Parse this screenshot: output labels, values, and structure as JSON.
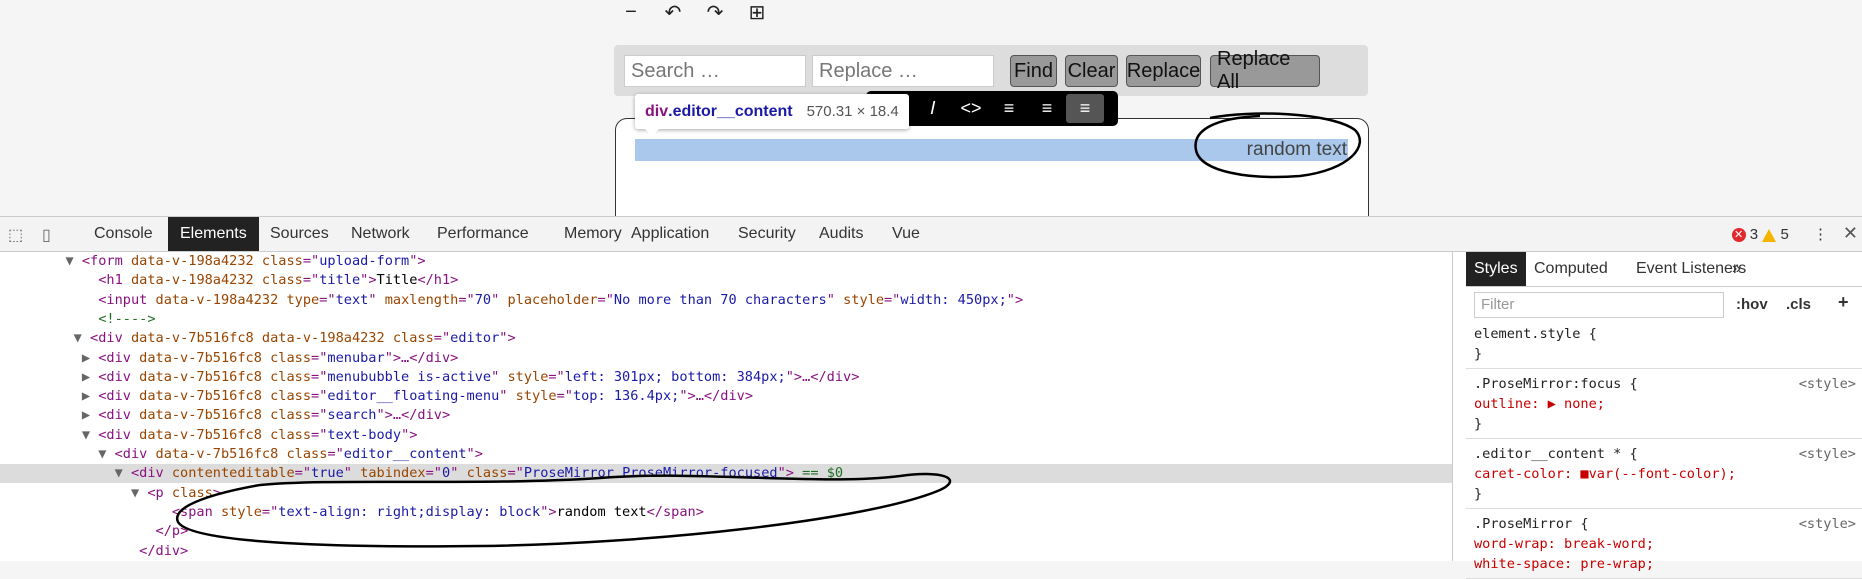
{
  "editor_toolbar": {
    "icons": [
      "minus-icon",
      "undo-icon",
      "redo-icon",
      "table-icon"
    ],
    "glyphs": [
      "−",
      "↶",
      "↷",
      "⊞"
    ]
  },
  "search": {
    "search_placeholder": "Search …",
    "replace_placeholder": "Replace …",
    "find_label": "Find",
    "clear_label": "Clear",
    "replace_label": "Replace",
    "replace_all_label": "Replace All"
  },
  "inspect_tooltip": {
    "tag": "div",
    "class": ".editor__content",
    "size": "570.31 × 18.4"
  },
  "menububble": {
    "icons": [
      "italic-icon",
      "code-icon",
      "align-left-icon",
      "align-center-icon",
      "align-right-icon"
    ],
    "glyphs": [
      "𝐼",
      "<>",
      "≡",
      "≡",
      "≡"
    ]
  },
  "editor": {
    "text": "random text"
  },
  "devtools": {
    "tabs": [
      "Console",
      "Elements",
      "Sources",
      "Network",
      "Performance",
      "Memory",
      "Application",
      "Security",
      "Audits",
      "Vue"
    ],
    "active_tab": "Elements",
    "error_count": "3",
    "warning_count": "5",
    "dom": [
      {
        "indent": "        ",
        "arrow": "▼",
        "html": [
          [
            "tg",
            "<form "
          ],
          [
            "an",
            "data-v-198a4232 class"
          ],
          [
            "tg",
            "=\""
          ],
          [
            "av",
            "upload-form"
          ],
          [
            "tg",
            "\">"
          ]
        ]
      },
      {
        "indent": "          ",
        "arrow": " ",
        "html": [
          [
            "tg",
            "<h1 "
          ],
          [
            "an",
            "data-v-198a4232 class"
          ],
          [
            "tg",
            "=\""
          ],
          [
            "av",
            "title"
          ],
          [
            "tg",
            "\">"
          ],
          [
            "tx",
            "Title"
          ],
          [
            "tg",
            "</h1>"
          ]
        ]
      },
      {
        "indent": "          ",
        "arrow": " ",
        "html": [
          [
            "tg",
            "<input "
          ],
          [
            "an",
            "data-v-198a4232 type"
          ],
          [
            "tg",
            "=\""
          ],
          [
            "av",
            "text"
          ],
          [
            "tg",
            "\" "
          ],
          [
            "an",
            "maxlength"
          ],
          [
            "tg",
            "=\""
          ],
          [
            "av",
            "70"
          ],
          [
            "tg",
            "\" "
          ],
          [
            "an",
            "placeholder"
          ],
          [
            "tg",
            "=\""
          ],
          [
            "av",
            "No more than 70 characters"
          ],
          [
            "tg",
            "\" "
          ],
          [
            "an",
            "style"
          ],
          [
            "tg",
            "=\""
          ],
          [
            "av",
            "width: 450px;"
          ],
          [
            "tg",
            "\">"
          ]
        ]
      },
      {
        "indent": "          ",
        "arrow": " ",
        "html": [
          [
            "cm",
            "<!---->"
          ]
        ]
      },
      {
        "indent": "         ",
        "arrow": "▼",
        "html": [
          [
            "tg",
            "<div "
          ],
          [
            "an",
            "data-v-7b516fc8 data-v-198a4232 class"
          ],
          [
            "tg",
            "=\""
          ],
          [
            "av",
            "editor"
          ],
          [
            "tg",
            "\">"
          ]
        ]
      },
      {
        "indent": "          ",
        "arrow": "▶",
        "html": [
          [
            "tg",
            "<div "
          ],
          [
            "an",
            "data-v-7b516fc8 class"
          ],
          [
            "tg",
            "=\""
          ],
          [
            "av",
            "menubar"
          ],
          [
            "tg",
            "\">…</div>"
          ]
        ]
      },
      {
        "indent": "          ",
        "arrow": "▶",
        "html": [
          [
            "tg",
            "<div "
          ],
          [
            "an",
            "data-v-7b516fc8 class"
          ],
          [
            "tg",
            "=\""
          ],
          [
            "av",
            "menububble is-active"
          ],
          [
            "tg",
            "\" "
          ],
          [
            "an",
            "style"
          ],
          [
            "tg",
            "=\""
          ],
          [
            "av",
            "left: 301px; bottom: 384px;"
          ],
          [
            "tg",
            "\">…</div>"
          ]
        ]
      },
      {
        "indent": "          ",
        "arrow": "▶",
        "html": [
          [
            "tg",
            "<div "
          ],
          [
            "an",
            "data-v-7b516fc8 class"
          ],
          [
            "tg",
            "=\""
          ],
          [
            "av",
            "editor__floating-menu"
          ],
          [
            "tg",
            "\" "
          ],
          [
            "an",
            "style"
          ],
          [
            "tg",
            "=\""
          ],
          [
            "av",
            "top: 136.4px;"
          ],
          [
            "tg",
            "\">…</div>"
          ]
        ]
      },
      {
        "indent": "          ",
        "arrow": "▶",
        "html": [
          [
            "tg",
            "<div "
          ],
          [
            "an",
            "data-v-7b516fc8 class"
          ],
          [
            "tg",
            "=\""
          ],
          [
            "av",
            "search"
          ],
          [
            "tg",
            "\">…</div>"
          ]
        ]
      },
      {
        "indent": "          ",
        "arrow": "▼",
        "html": [
          [
            "tg",
            "<div "
          ],
          [
            "an",
            "data-v-7b516fc8 class"
          ],
          [
            "tg",
            "=\""
          ],
          [
            "av",
            "text-body"
          ],
          [
            "tg",
            "\">"
          ]
        ]
      },
      {
        "indent": "            ",
        "arrow": "▼",
        "html": [
          [
            "tg",
            "<div "
          ],
          [
            "an",
            "data-v-7b516fc8 class"
          ],
          [
            "tg",
            "=\""
          ],
          [
            "av",
            "editor__content"
          ],
          [
            "tg",
            "\">"
          ]
        ]
      },
      {
        "indent": "              ",
        "arrow": "▼",
        "html": [
          [
            "tg",
            "<div "
          ],
          [
            "an",
            "contenteditable"
          ],
          [
            "tg",
            "=\""
          ],
          [
            "av",
            "true"
          ],
          [
            "tg",
            "\" "
          ],
          [
            "an",
            "tabindex"
          ],
          [
            "tg",
            "=\""
          ],
          [
            "av",
            "0"
          ],
          [
            "tg",
            "\" "
          ],
          [
            "an",
            "class"
          ],
          [
            "tg",
            "=\""
          ],
          [
            "av",
            "ProseMirror ProseMirror-focused"
          ],
          [
            "tg",
            "\">"
          ],
          [
            "cm",
            " == $0"
          ]
        ]
      },
      {
        "indent": "                ",
        "arrow": "▼",
        "html": [
          [
            "tg",
            "<p "
          ],
          [
            "an",
            "class"
          ],
          [
            "tg",
            ">"
          ]
        ]
      },
      {
        "indent": "                   ",
        "arrow": " ",
        "html": [
          [
            "tg",
            "<span "
          ],
          [
            "an",
            "style"
          ],
          [
            "tg",
            "=\""
          ],
          [
            "av",
            "text-align: right;display: block"
          ],
          [
            "tg",
            "\">"
          ],
          [
            "tx",
            "random text"
          ],
          [
            "tg",
            "</span>"
          ]
        ]
      },
      {
        "indent": "                 ",
        "arrow": " ",
        "html": [
          [
            "tg",
            "</p>"
          ]
        ]
      },
      {
        "indent": "               ",
        "arrow": " ",
        "html": [
          [
            "tg",
            "</div>"
          ]
        ]
      }
    ],
    "selected_line": 11,
    "styles_tabs": [
      "Styles",
      "Computed",
      "Event Listeners",
      "»"
    ],
    "filter_placeholder": "Filter",
    "hov": ":hov",
    "cls": ".cls",
    "add_rule": "+",
    "rules": [
      {
        "lines": [
          [
            "sel",
            "element.style {"
          ],
          [
            "sel",
            "}"
          ]
        ],
        "src": ""
      },
      {
        "lines": [
          [
            "sel",
            ".ProseMirror:focus {"
          ],
          [
            "prop",
            "  outline: ▶ none;"
          ],
          [
            "sel",
            "}"
          ]
        ],
        "src": "<style>"
      },
      {
        "lines": [
          [
            "sel",
            ".editor__content * {"
          ],
          [
            "prop",
            "  caret-color: ■var(--font-color);"
          ],
          [
            "sel",
            "}"
          ]
        ],
        "src": "<style>"
      },
      {
        "lines": [
          [
            "sel",
            ".ProseMirror {"
          ],
          [
            "prop",
            "  word-wrap: break-word;"
          ],
          [
            "prop",
            "  white-space: pre-wrap;"
          ]
        ],
        "src": "<style>"
      }
    ]
  }
}
